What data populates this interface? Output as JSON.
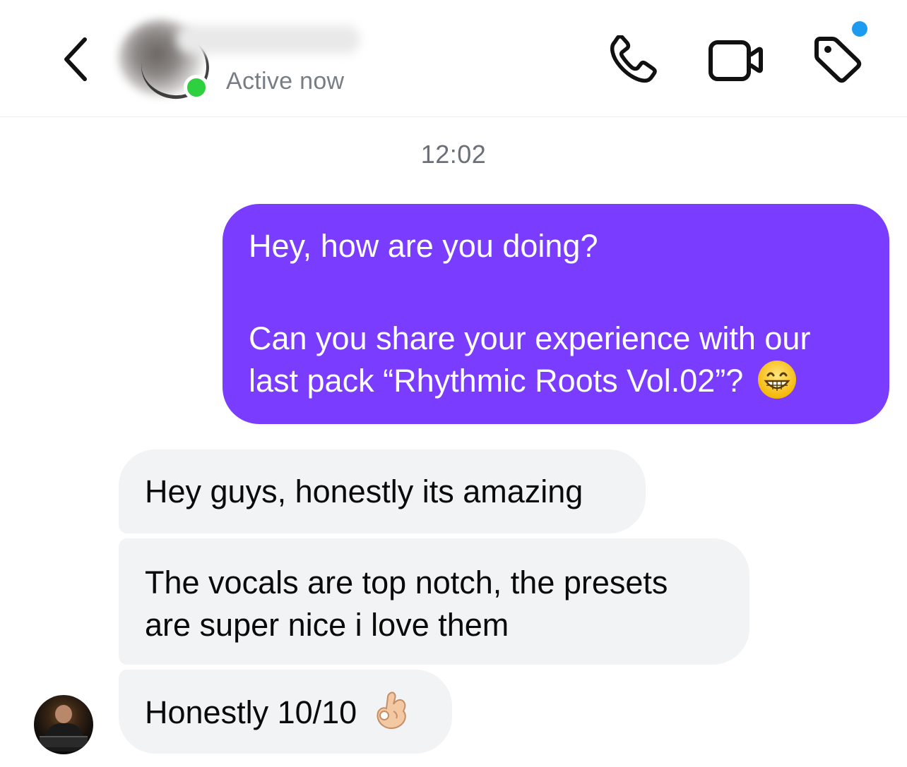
{
  "header": {
    "status": "Active now",
    "icons": [
      "back-icon",
      "phone-icon",
      "video-camera-icon",
      "tag-icon"
    ],
    "status_color": "#2fd03f",
    "badge_color": "#1d9bf0"
  },
  "conversation": {
    "timestamp": "12:02",
    "outgoing": {
      "line1": "Hey, how are you doing?",
      "line2": "Can you share your experience with our",
      "line3": "last pack “Rhythmic Roots Vol.02”?",
      "emoji": "grinning-face-emoji",
      "color": "#7a3cff"
    },
    "incoming": [
      {
        "text": "Hey guys, honestly its amazing"
      },
      {
        "line1": "The vocals are top notch, the presets",
        "line2": "are super nice i love them"
      },
      {
        "text": "Honestly 10/10",
        "emoji": "ok-hand-emoji"
      }
    ],
    "incoming_color": "#f1f3f4"
  }
}
